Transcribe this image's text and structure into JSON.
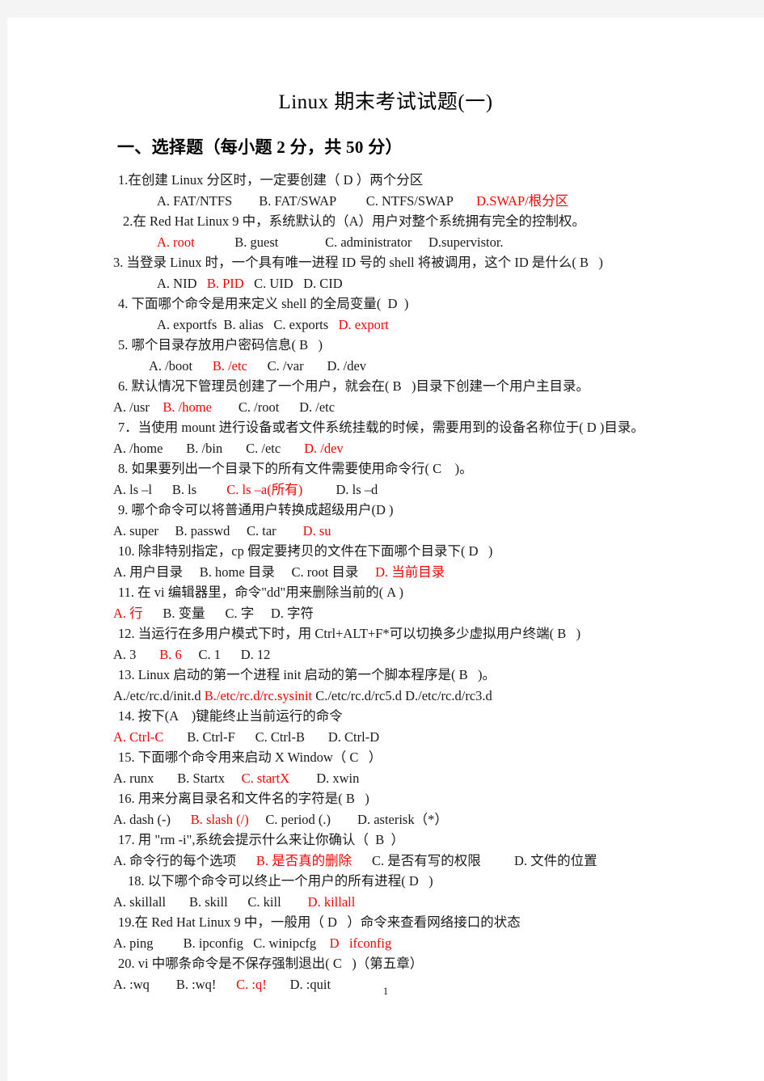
{
  "document": {
    "title": "Linux  期末考试试题(一)",
    "section_heading": "一、选择题（每小题 2 分，共 50 分）",
    "page_number": "1"
  },
  "questions": [
    {
      "id": "q1",
      "stem": "1.在创建 Linux 分区时，一定要创建（ D ）两个分区",
      "stem_indent": 1,
      "opts_indent": 2,
      "options": [
        {
          "label": "A. FAT/NTFS",
          "answer": false,
          "gap": "        "
        },
        {
          "label": "B. FAT/SWAP",
          "answer": false,
          "gap": "         "
        },
        {
          "label": "C. NTFS/SWAP",
          "answer": false,
          "gap": "       "
        },
        {
          "label": "D.SWAP/根分区",
          "answer": true,
          "gap": ""
        }
      ]
    },
    {
      "id": "q2",
      "stem": "2.在 Red Hat Linux 9 中，系统默认的（A）用户对整个系统拥有完全的控制权。",
      "stem_indent": 2,
      "opts_indent": 2,
      "options": [
        {
          "label": "A. root",
          "answer": true,
          "gap": "            "
        },
        {
          "label": "B. guest",
          "answer": false,
          "gap": "              "
        },
        {
          "label": "C. administrator",
          "answer": false,
          "gap": "     "
        },
        {
          "label": "D.supervistor.",
          "answer": false,
          "gap": ""
        }
      ]
    },
    {
      "id": "q3",
      "stem": "3. 当登录 Linux 时，一个具有唯一进程 ID 号的 shell 将被调用，这个 ID 是什么( B   )",
      "stem_indent": 0,
      "opts_indent": 2,
      "options": [
        {
          "label": "A. NID",
          "answer": false,
          "gap": "   "
        },
        {
          "label": "B. PID",
          "answer": true,
          "gap": "   "
        },
        {
          "label": "C. UID",
          "answer": false,
          "gap": "   "
        },
        {
          "label": "D. CID",
          "answer": false,
          "gap": ""
        }
      ]
    },
    {
      "id": "q4",
      "stem": "4. 下面哪个命令是用来定义 shell 的全局变量(  D  )",
      "stem_indent": 1,
      "opts_indent": 2,
      "options": [
        {
          "label": "A. exportfs",
          "answer": false,
          "gap": "  "
        },
        {
          "label": "B. alias",
          "answer": false,
          "gap": "   "
        },
        {
          "label": "C. exports",
          "answer": false,
          "gap": "   "
        },
        {
          "label": "D. export",
          "answer": true,
          "gap": ""
        }
      ]
    },
    {
      "id": "q5",
      "stem": "5. 哪个目录存放用户密码信息( B   )",
      "stem_indent": 1,
      "opts_indent": 1,
      "options": [
        {
          "label": "A. /boot",
          "answer": false,
          "gap": "      "
        },
        {
          "label": "B. /etc",
          "answer": true,
          "gap": "      "
        },
        {
          "label": "C. /var",
          "answer": false,
          "gap": "       "
        },
        {
          "label": "D. /dev",
          "answer": false,
          "gap": ""
        }
      ]
    },
    {
      "id": "q6",
      "stem": "6. 默认情况下管理员创建了一个用户，就会在( B   )目录下创建一个用户主目录。",
      "stem_indent": 1,
      "opts_indent": 0,
      "options": [
        {
          "label": "A. /usr",
          "answer": false,
          "gap": "    "
        },
        {
          "label": "B. /home",
          "answer": true,
          "gap": "        "
        },
        {
          "label": "C. /root",
          "answer": false,
          "gap": "      "
        },
        {
          "label": "D. /etc",
          "answer": false,
          "gap": ""
        }
      ]
    },
    {
      "id": "q7",
      "stem": "7．当使用 mount 进行设备或者文件系统挂载的时候，需要用到的设备名称位于( D )目录。",
      "stem_indent": 1,
      "opts_indent": 0,
      "options": [
        {
          "label": "A. /home",
          "answer": false,
          "gap": "       "
        },
        {
          "label": "B. /bin",
          "answer": false,
          "gap": "       "
        },
        {
          "label": "C. /etc",
          "answer": false,
          "gap": "       "
        },
        {
          "label": "D. /dev",
          "answer": true,
          "gap": ""
        }
      ]
    },
    {
      "id": "q8",
      "stem": "8. 如果要列出一个目录下的所有文件需要使用命令行( C    )。",
      "stem_indent": 1,
      "opts_indent": 0,
      "options": [
        {
          "label": "A. ls –l",
          "answer": false,
          "gap": "      "
        },
        {
          "label": "B. ls",
          "answer": false,
          "gap": "         "
        },
        {
          "label": "C. ls –a(所有)",
          "answer": true,
          "gap": "          "
        },
        {
          "label": "D. ls –d",
          "answer": false,
          "gap": ""
        }
      ]
    },
    {
      "id": "q9",
      "stem": "9. 哪个命令可以将普通用户转换成超级用户(D )",
      "stem_indent": 1,
      "opts_indent": 0,
      "options": [
        {
          "label": "A. super",
          "answer": false,
          "gap": "     "
        },
        {
          "label": "B. passwd",
          "answer": false,
          "gap": "     "
        },
        {
          "label": "C. tar",
          "answer": false,
          "gap": "        "
        },
        {
          "label": "D. su",
          "answer": true,
          "gap": ""
        }
      ]
    },
    {
      "id": "q10",
      "stem": "10. 除非特别指定，cp 假定要拷贝的文件在下面哪个目录下( D   )",
      "stem_indent": 1,
      "opts_indent": 0,
      "options": [
        {
          "label": "A. 用户目录",
          "answer": false,
          "gap": "     "
        },
        {
          "label": "B. home 目录",
          "answer": false,
          "gap": "     "
        },
        {
          "label": "C. root 目录",
          "answer": false,
          "gap": "     "
        },
        {
          "label": "D. 当前目录",
          "answer": true,
          "gap": ""
        }
      ]
    },
    {
      "id": "q11",
      "stem": "11. 在 vi 编辑器里，命令\"dd\"用来删除当前的( A )",
      "stem_indent": 1,
      "opts_indent": 0,
      "options": [
        {
          "label": "A. 行",
          "answer": true,
          "gap": "      "
        },
        {
          "label": "B. 变量",
          "answer": false,
          "gap": "      "
        },
        {
          "label": "C. 字",
          "answer": false,
          "gap": "     "
        },
        {
          "label": "D. 字符",
          "answer": false,
          "gap": ""
        }
      ]
    },
    {
      "id": "q12",
      "stem": "12. 当运行在多用户模式下时，用 Ctrl+ALT+F*可以切换多少虚拟用户终端( B   )",
      "stem_indent": 1,
      "opts_indent": 0,
      "options": [
        {
          "label": "A. 3",
          "answer": false,
          "gap": "       "
        },
        {
          "label": "B. 6",
          "answer": true,
          "gap": "     "
        },
        {
          "label": "C. 1",
          "answer": false,
          "gap": "      "
        },
        {
          "label": "D. 12",
          "answer": false,
          "gap": ""
        }
      ]
    },
    {
      "id": "q13",
      "stem": "13. Linux 启动的第一个进程 init 启动的第一个脚本程序是( B   )。",
      "stem_indent": 1,
      "opts_indent": 0,
      "options": [
        {
          "label": "A./etc/rc.d/init.d",
          "answer": false,
          "gap": " "
        },
        {
          "label": "B./etc/rc.d/rc.sysinit",
          "answer": true,
          "gap": " "
        },
        {
          "label": "C./etc/rc.d/rc5.d",
          "answer": false,
          "gap": " "
        },
        {
          "label": "D./etc/rc.d/rc3.d",
          "answer": false,
          "gap": ""
        }
      ]
    },
    {
      "id": "q14",
      "stem": "14. 按下(A    )键能终止当前运行的命令",
      "stem_indent": 1,
      "opts_indent": 0,
      "options": [
        {
          "label": "A. Ctrl-C",
          "answer": true,
          "gap": "       "
        },
        {
          "label": "B. Ctrl-F",
          "answer": false,
          "gap": "      "
        },
        {
          "label": "C. Ctrl-B",
          "answer": false,
          "gap": "       "
        },
        {
          "label": "D. Ctrl-D",
          "answer": false,
          "gap": ""
        }
      ]
    },
    {
      "id": "q15",
      "stem": "15. 下面哪个命令用来启动 X Window（ C   ）",
      "stem_indent": 1,
      "opts_indent": 0,
      "options": [
        {
          "label": "A. runx",
          "answer": false,
          "gap": "       "
        },
        {
          "label": "B. Startx",
          "answer": false,
          "gap": "     "
        },
        {
          "label": "C. startX",
          "answer": true,
          "gap": "        "
        },
        {
          "label": "D. xwin",
          "answer": false,
          "gap": ""
        }
      ]
    },
    {
      "id": "q16",
      "stem": "16. 用来分离目录名和文件名的字符是( B   )",
      "stem_indent": 1,
      "opts_indent": 0,
      "options": [
        {
          "label": "A. dash (-)",
          "answer": false,
          "gap": "      "
        },
        {
          "label": "B. slash (/)",
          "answer": true,
          "gap": "     "
        },
        {
          "label": "C. period (.)",
          "answer": false,
          "gap": "        "
        },
        {
          "label": "D. asterisk（*）",
          "answer": false,
          "gap": ""
        }
      ]
    },
    {
      "id": "q17",
      "stem": "17. 用 \"rm -i\",系统会提示什么来让你确认（  B  ）",
      "stem_indent": 1,
      "opts_indent": 0,
      "options": [
        {
          "label": "A. 命令行的每个选项",
          "answer": false,
          "gap": "      "
        },
        {
          "label": "B. 是否真的删除",
          "answer": true,
          "gap": "      "
        },
        {
          "label": "C. 是否有写的权限",
          "answer": false,
          "gap": "          "
        },
        {
          "label": "D. 文件的位置",
          "answer": false,
          "gap": ""
        }
      ]
    },
    {
      "id": "q18",
      "stem": "18. 以下哪个命令可以终止一个用户的所有进程( D   )",
      "stem_indent": 3,
      "opts_indent": 0,
      "options": [
        {
          "label": "A. skillall",
          "answer": false,
          "gap": "       "
        },
        {
          "label": "B. skill",
          "answer": false,
          "gap": "      "
        },
        {
          "label": "C. kill",
          "answer": false,
          "gap": "        "
        },
        {
          "label": "D. killall",
          "answer": true,
          "gap": ""
        }
      ]
    },
    {
      "id": "q19",
      "stem": "19.在 Red Hat Linux 9 中，一般用（ D   ）命令来查看网络接口的状态",
      "stem_indent": 1,
      "opts_indent": 0,
      "options": [
        {
          "label": "A. ping",
          "answer": false,
          "gap": "         "
        },
        {
          "label": "B. ipconfig",
          "answer": false,
          "gap": "   "
        },
        {
          "label": "C. winipcfg",
          "answer": false,
          "gap": "    "
        },
        {
          "label": "D   ifconfig",
          "answer": true,
          "gap": ""
        }
      ]
    },
    {
      "id": "q20",
      "stem": "20. vi 中哪条命令是不保存强制退出( C   )（第五章）",
      "stem_indent": 1,
      "opts_indent": 0,
      "options": [
        {
          "label": "A. :wq",
          "answer": false,
          "gap": "        "
        },
        {
          "label": "B. :wq!",
          "answer": false,
          "gap": "      "
        },
        {
          "label": "C. :q!",
          "answer": true,
          "gap": "       "
        },
        {
          "label": "D. :quit",
          "answer": false,
          "gap": ""
        }
      ]
    }
  ],
  "colors": {
    "answer_red": "#ff0000",
    "text_black": "#1a1a1a",
    "page_background": "#ffffff",
    "canvas_background": "#f4f4f4"
  }
}
